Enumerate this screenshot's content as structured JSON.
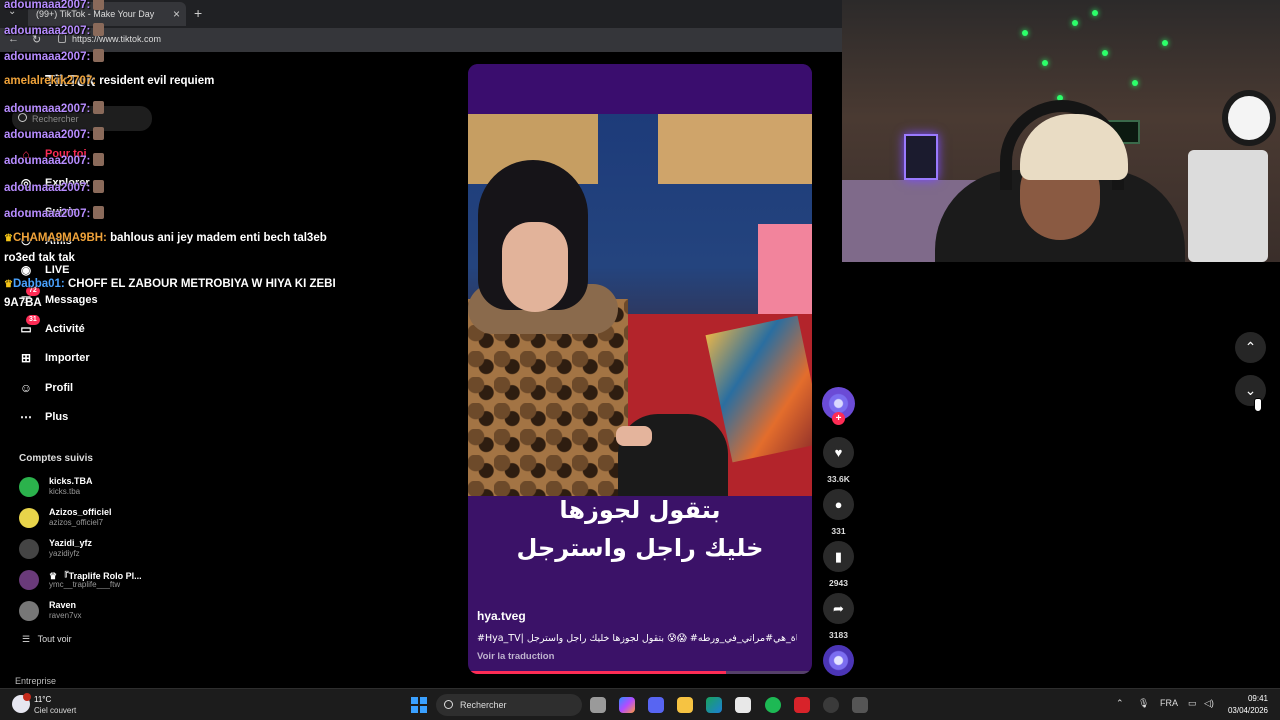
{
  "browser": {
    "tab_title": "(99+) TikTok - Make Your Day",
    "url": "https://www.tiktok.com",
    "new_tab_symbol": "+",
    "close_symbol": "×"
  },
  "sidebar": {
    "logo": "TikTok",
    "search_placeholder": "Rechercher",
    "nav": [
      {
        "label": "Pour toi",
        "icon": "home-icon",
        "badge": ""
      },
      {
        "label": "Explorer",
        "icon": "compass-icon",
        "badge": ""
      },
      {
        "label": "Suivis",
        "icon": "following-icon",
        "badge": ""
      },
      {
        "label": "Amis",
        "icon": "friends-icon",
        "badge": ""
      },
      {
        "label": "LIVE",
        "icon": "live-icon",
        "badge": ""
      },
      {
        "label": "Messages",
        "icon": "messages-icon",
        "badge": "72"
      },
      {
        "label": "Activité",
        "icon": "activity-icon",
        "badge": "31"
      },
      {
        "label": "Importer",
        "icon": "upload-icon",
        "badge": ""
      },
      {
        "label": "Profil",
        "icon": "profile-icon",
        "badge": ""
      },
      {
        "label": "Plus",
        "icon": "more-icon",
        "badge": ""
      }
    ],
    "following_title": "Comptes suivis",
    "following": [
      {
        "name": "kicks.TBA",
        "handle": "kicks.tba",
        "color": "#2bb24c"
      },
      {
        "name": "Azizos_officiel",
        "handle": "azizos_officiel7",
        "color": "#e8d44a"
      },
      {
        "name": "Yazidi_yfz",
        "handle": "yazidiyfz",
        "color": "#444444"
      },
      {
        "name": "♛ 『Traplife Rolo Pl...",
        "handle": "ymc__traplife___ftw",
        "color": "#6a3a7a"
      },
      {
        "name": "Raven",
        "handle": "raven7vx",
        "color": "#777777"
      }
    ],
    "see_all": "Tout voir",
    "enterprise": "Entreprise"
  },
  "chat": [
    {
      "user": "adoumaaa2007:",
      "msg": "",
      "emote": true,
      "color": "u"
    },
    {
      "user": "adoumaaa2007:",
      "msg": "",
      "emote": true,
      "color": "u"
    },
    {
      "user": "adoumaaa2007:",
      "msg": "",
      "emote": true,
      "color": "u"
    },
    {
      "user": "amelalrekik2707:",
      "msg": "resident evil requiem",
      "emote": false,
      "color": "u2"
    },
    {
      "user": "adoumaaa2007:",
      "msg": "",
      "emote": true,
      "color": "u"
    },
    {
      "user": "adoumaaa2007:",
      "msg": "",
      "emote": true,
      "color": "u"
    },
    {
      "user": "adoumaaa2007:",
      "msg": "",
      "emote": true,
      "color": "u"
    },
    {
      "user": "adoumaaa2007:",
      "msg": "",
      "emote": true,
      "color": "u"
    },
    {
      "user": "adoumaaa2007:",
      "msg": "",
      "emote": true,
      "color": "u"
    },
    {
      "user": "CHAMA9MA9BH:",
      "msg": "bahlous ani jey madem enti bech tal3eb",
      "emote": false,
      "color": "u2",
      "crown": true
    },
    {
      "user": "",
      "msg": "ro3ed tak tak",
      "emote": false,
      "color": "u"
    },
    {
      "user": "Dabba01:",
      "msg": "CHOFF EL ZABOUR METROBIYA W HIYA KI ZEBI",
      "emote": false,
      "color": "u3",
      "crown": true
    },
    {
      "user": "",
      "msg": "9A7BA",
      "emote": false,
      "color": "u"
    }
  ],
  "video": {
    "subtitle_line1": "بتقول لجوزها",
    "subtitle_line2": "خليك راجل واسترجل",
    "author": "hya.tveg",
    "caption": "#Hya_TV| قناة_هي#مراتي_في_ورطه# 😱😰 بتقول لجوزها خليك راجل واسترجل",
    "translate": "Voir la traduction",
    "progress": 0.75
  },
  "actions": {
    "likes": "33.6K",
    "comments": "331",
    "saves": "2943",
    "shares": "3183",
    "follow_symbol": "+"
  },
  "taskbar": {
    "temperature": "11°C",
    "condition": "Ciel couvert",
    "search_placeholder": "Rechercher",
    "language": "FRA",
    "time": "09:41",
    "date": "03/04/2026"
  }
}
